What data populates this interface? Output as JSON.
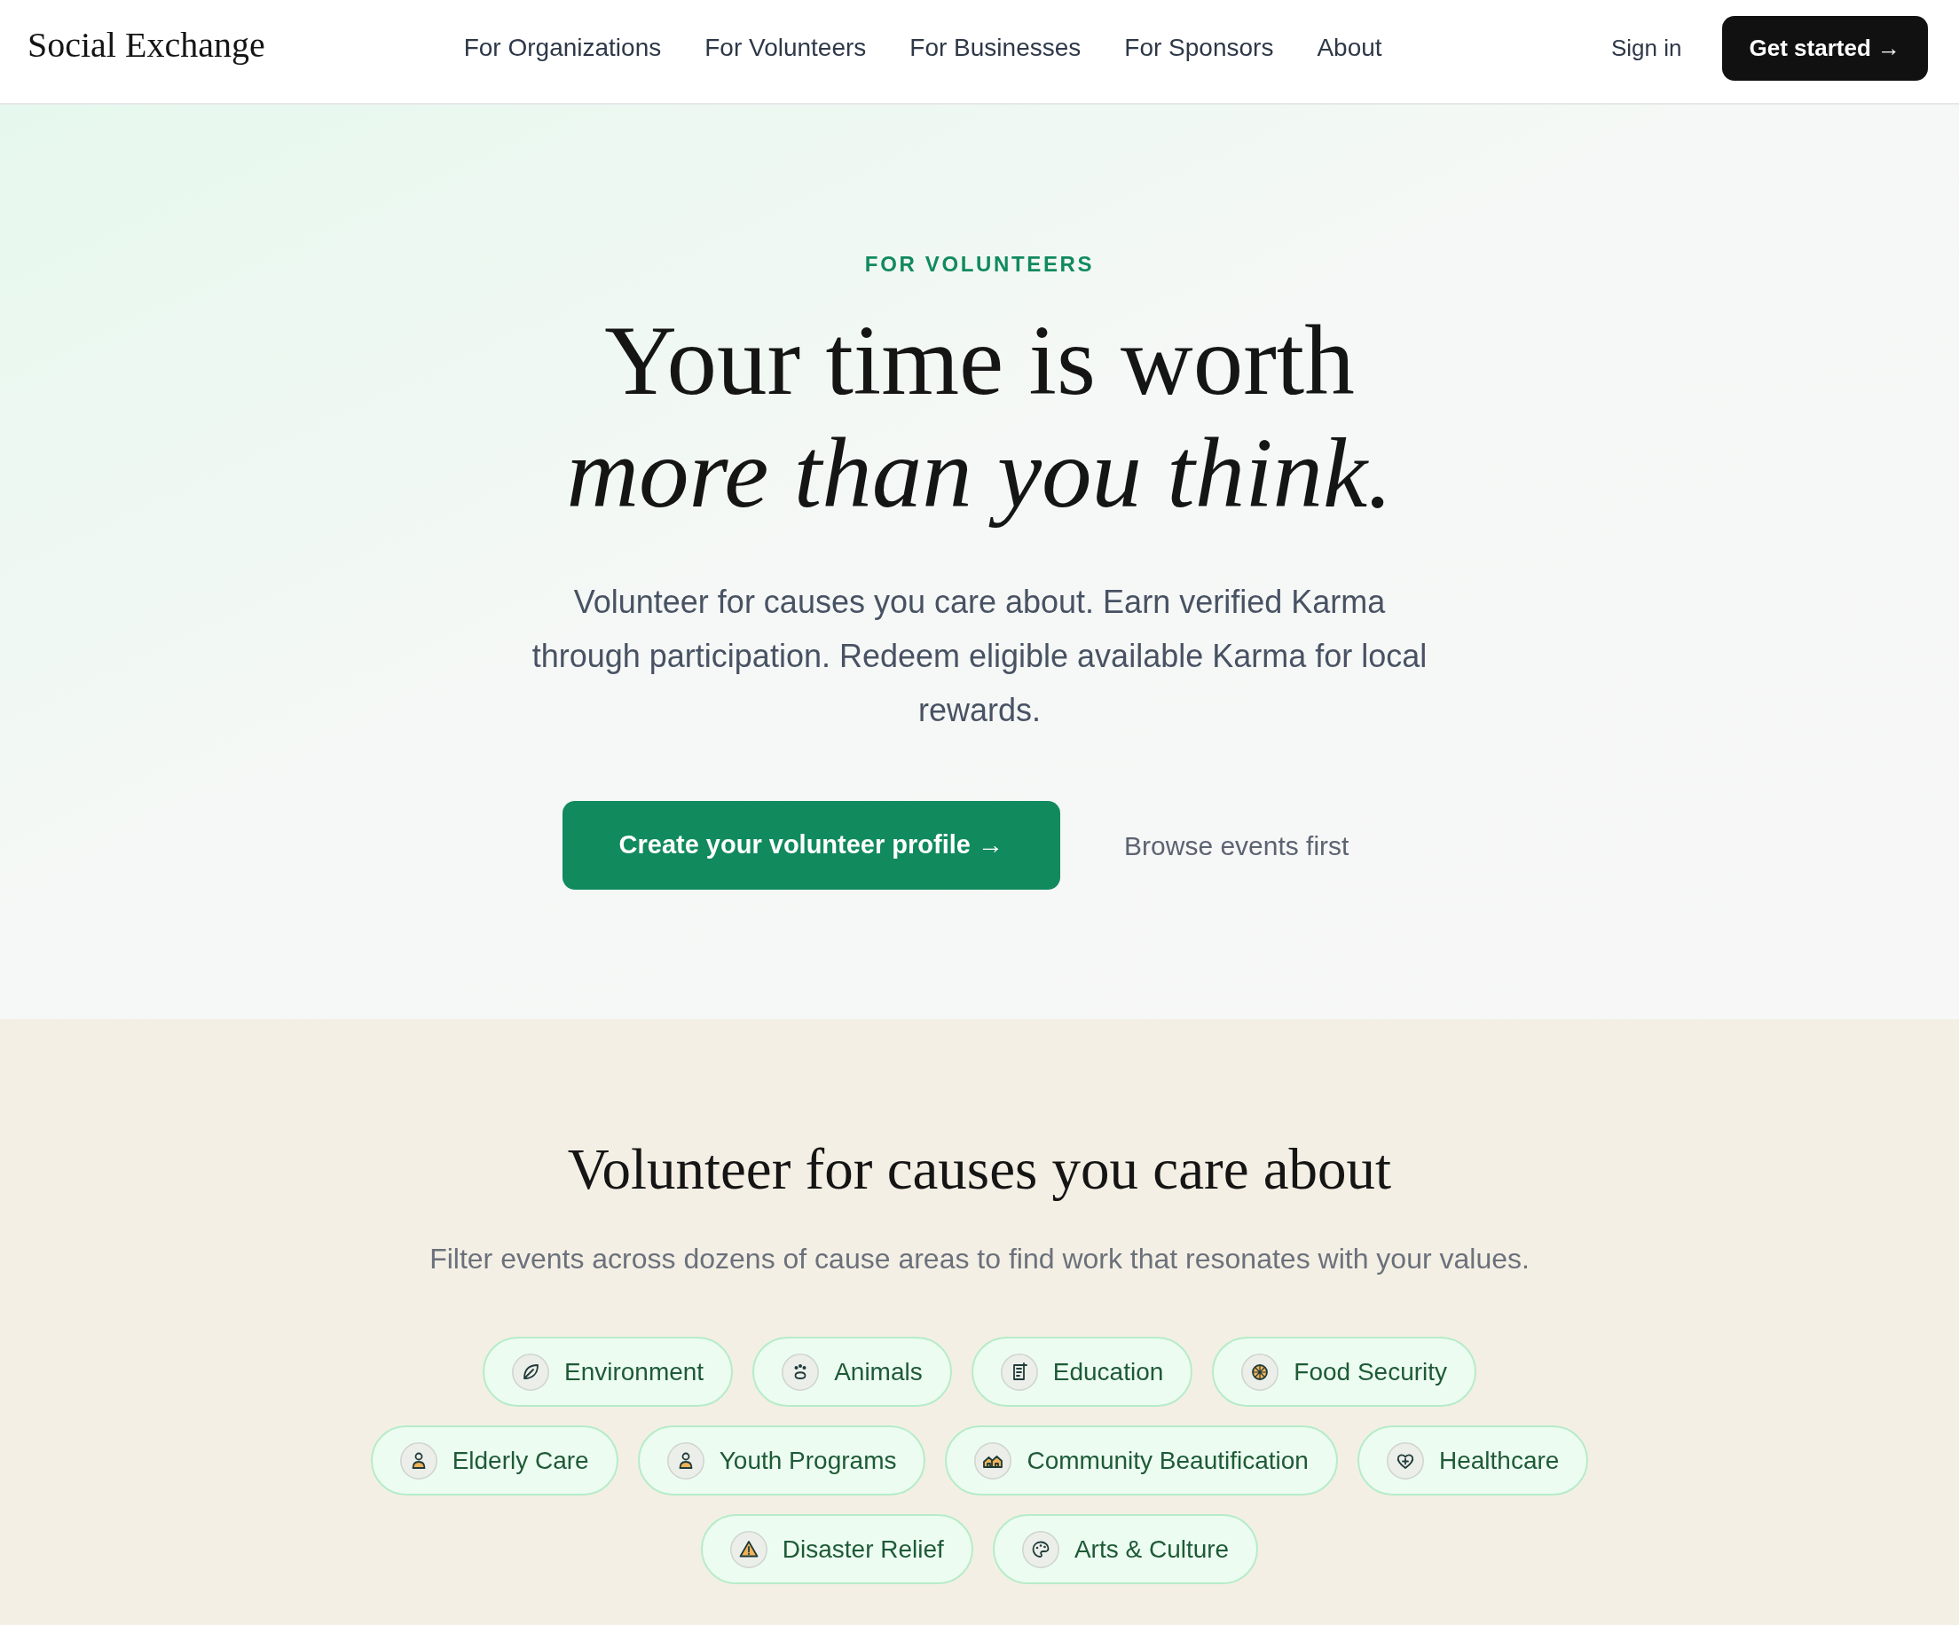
{
  "header": {
    "logo": "Social Exchange",
    "nav": [
      "For Organizations",
      "For Volunteers",
      "For Businesses",
      "For Sponsors",
      "About"
    ],
    "sign_in": "Sign in",
    "cta": "Get started →"
  },
  "hero": {
    "eyebrow": "FOR VOLUNTEERS",
    "title": "Your time is worth *more than you think.*",
    "description": "Volunteer for causes you care about. Earn verified Karma through participation. Redeem eligible available Karma for local rewards.",
    "primary_button": "Create your volunteer profile →",
    "secondary_link": "Browse events first"
  },
  "causes": {
    "title": "Volunteer for causes you care about",
    "subtitle": "Filter events across dozens of cause areas to find work that resonates with your values.",
    "chips": [
      "Environment",
      "Animals",
      "Education",
      "Food Security",
      "Elderly Care",
      "Youth Programs",
      "Community Beautification",
      "Healthcare",
      "Disaster Relief",
      "Arts & Culture"
    ]
  }
}
